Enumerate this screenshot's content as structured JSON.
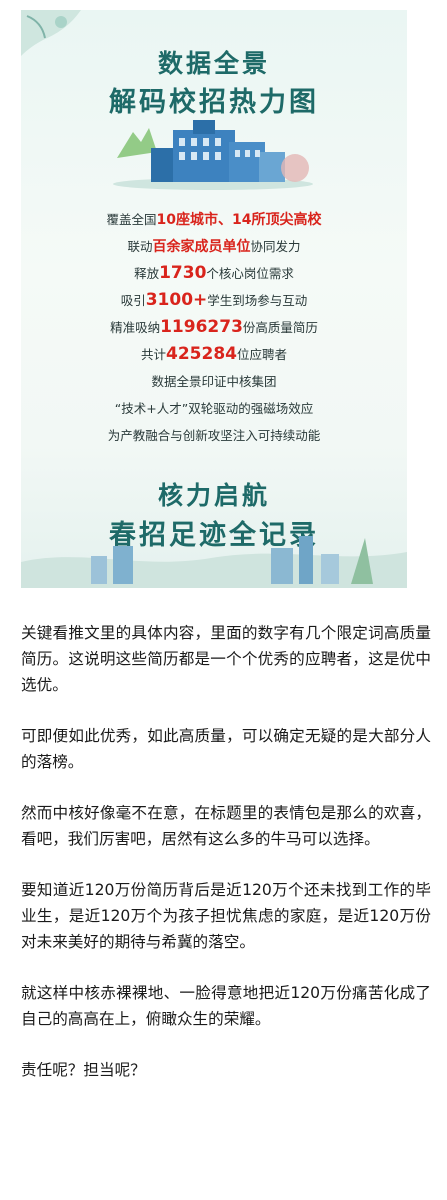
{
  "poster": {
    "title_line1": "数据全景",
    "title_line2": "解码校招热力图",
    "footer_line1": "核力启航",
    "footer_line2": "春招足迹全记录",
    "lines": [
      [
        {
          "t": "覆盖全国"
        },
        {
          "t": "10座城市、14所顶尖高校",
          "s": "hl"
        }
      ],
      [
        {
          "t": "联动"
        },
        {
          "t": "百余家成员单位",
          "s": "hl"
        },
        {
          "t": "协同发力"
        }
      ],
      [
        {
          "t": "释放"
        },
        {
          "t": "1730",
          "s": "big"
        },
        {
          "t": "个核心岗位需求"
        }
      ],
      [
        {
          "t": "吸引"
        },
        {
          "t": "3100+",
          "s": "big"
        },
        {
          "t": "学生到场参与互动"
        }
      ],
      [
        {
          "t": "精准吸纳"
        },
        {
          "t": "1196273",
          "s": "big"
        },
        {
          "t": "份高质量简历"
        }
      ],
      [
        {
          "t": "共计"
        },
        {
          "t": "425284",
          "s": "big"
        },
        {
          "t": "位应聘者"
        }
      ],
      [
        {
          "t": "数据全景印证中核集团"
        }
      ],
      [
        {
          "t": "“技术+人才”双轮驱动的强磁场效应"
        }
      ],
      [
        {
          "t": "为产教融合与创新攻坚注入可持续动能"
        }
      ]
    ]
  },
  "article": {
    "paragraphs": [
      "关键看推文里的具体内容，里面的数字有几个限定词高质量简历。这说明这些简历都是一个个优秀的应聘者，这是优中选优。",
      "可即便如此优秀，如此高质量，可以确定无疑的是大部分人的落榜。",
      "然而中核好像毫不在意，在标题里的表情包是那么的欢喜，看吧，我们厉害吧，居然有这么多的牛马可以选择。",
      "要知道近120万份简历背后是近120万个还未找到工作的毕业生，是近120万个为孩子担忧焦虑的家庭，是近120万份对未来美好的期待与希冀的落空。",
      "就这样中核赤裸裸地、一脸得意地把近120万份痛苦化成了自己的高高在上，俯瞰众生的荣耀。",
      "责任呢？担当呢？"
    ]
  },
  "colors": {
    "title_teal": "#1e6a68",
    "highlight_red": "#d9241c",
    "poster_bg": "#eaf6f3"
  }
}
